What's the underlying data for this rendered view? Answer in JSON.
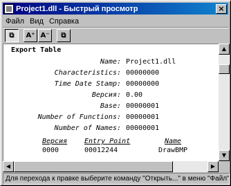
{
  "window": {
    "title": "Project1.dll - Быстрый просмотр",
    "close_label": "×"
  },
  "menu": {
    "items": [
      {
        "label": "Файл"
      },
      {
        "label": "Вид"
      },
      {
        "label": "Справка"
      }
    ]
  },
  "toolbar": {
    "buttons": [
      {
        "icon": "quick-view-icon",
        "label": "⧉"
      },
      {
        "icon": "increase-font-icon",
        "label": "A⁺"
      },
      {
        "icon": "decrease-font-icon",
        "label": "A⁻"
      },
      {
        "icon": "replace-window-icon",
        "label": "⧉"
      }
    ]
  },
  "content": {
    "section_title": "Export Table",
    "fields": [
      {
        "label": "Name:",
        "value": "Project1.dll"
      },
      {
        "label": "Characteristics:",
        "value": "00000000"
      },
      {
        "label": "Time Date Stamp:",
        "value": "00000000"
      },
      {
        "label": "Версия:",
        "value": "0.00"
      },
      {
        "label": "Base:",
        "value": "00000001"
      },
      {
        "label": "Number of Functions:",
        "value": "00000001"
      },
      {
        "label": "Number of Names:",
        "value": "00000001"
      }
    ],
    "table": {
      "headers": [
        "Версия",
        "Entry Point",
        "Name"
      ],
      "rows": [
        [
          "0000",
          "00012244",
          "DrawBMP"
        ]
      ]
    }
  },
  "scrollbars": {
    "up": "▲",
    "down": "▼",
    "left": "◀",
    "right": "▶"
  },
  "status": {
    "text": "Для перехода к правке выберите команду \"Открыть...\" в меню \"Файл\""
  }
}
